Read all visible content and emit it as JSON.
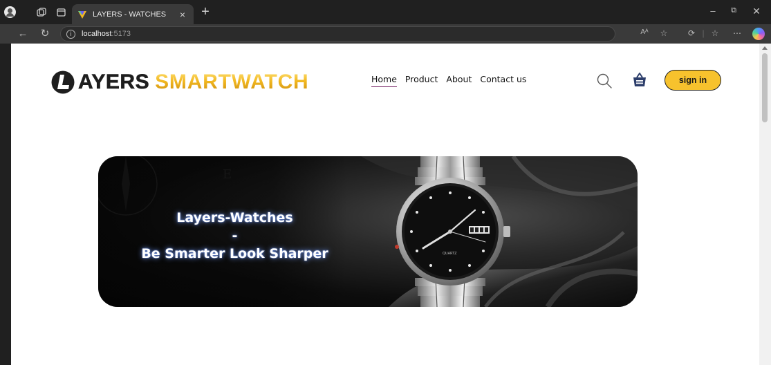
{
  "browser": {
    "tab_title": "LAYERS - WATCHES",
    "tab_close": "×",
    "new_tab": "+",
    "url_host": "localhost",
    "url_port": ":5173",
    "read_aloud": "Aᴬ",
    "info_glyph": "i"
  },
  "header": {
    "logo_part1": "AYERS",
    "logo_part2": "SMARTWATCH",
    "nav": [
      {
        "label": "Home",
        "active": true
      },
      {
        "label": "Product",
        "active": false
      },
      {
        "label": "About",
        "active": false
      },
      {
        "label": "Contact us",
        "active": false
      }
    ],
    "signin_label": "sign in"
  },
  "hero": {
    "line1": "Layers-Watches",
    "line2": "-",
    "line3": "Be Smarter Look Sharper",
    "watch_brand": "QUARTZ"
  },
  "colors": {
    "accent_yellow": "#f7c22d",
    "nav_underline": "#7a2a6a",
    "basket_blue": "#2d3e6b"
  }
}
